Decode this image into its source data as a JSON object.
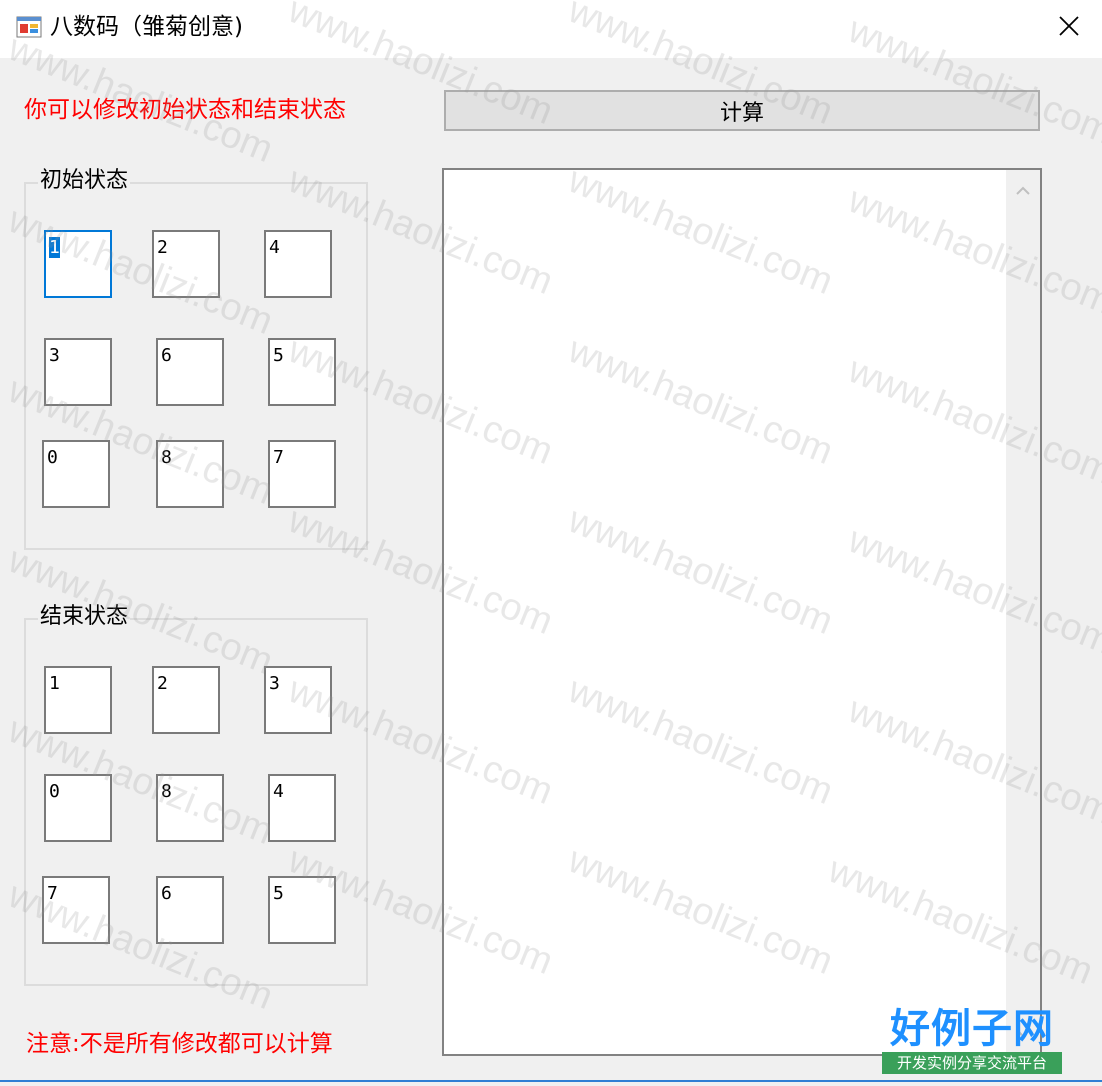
{
  "window": {
    "title": "八数码（雏菊创意)",
    "close_icon": "close-icon",
    "app_icon": "winforms-app-icon"
  },
  "hint_top": "你可以修改初始状态和结束状态",
  "hint_bottom": "注意:不是所有修改都可以计算",
  "calculate_button": "计算",
  "start_state": {
    "legend": "初始状态",
    "cells": [
      "1",
      "2",
      "4",
      "3",
      "6",
      "5",
      "0",
      "8",
      "7"
    ]
  },
  "end_state": {
    "legend": "结束状态",
    "cells": [
      "1",
      "2",
      "3",
      "0",
      "8",
      "4",
      "7",
      "6",
      "5"
    ]
  },
  "output": {
    "text": ""
  },
  "logo": {
    "title": "好例子网",
    "subtitle": "开发实例分享交流平台"
  },
  "watermark": {
    "text": "www.haolizi.com"
  },
  "colors": {
    "hint": "#ff0000",
    "focus": "#0078d7",
    "logo_blue": "#1e90ff",
    "logo_green": "#3aa05a"
  }
}
